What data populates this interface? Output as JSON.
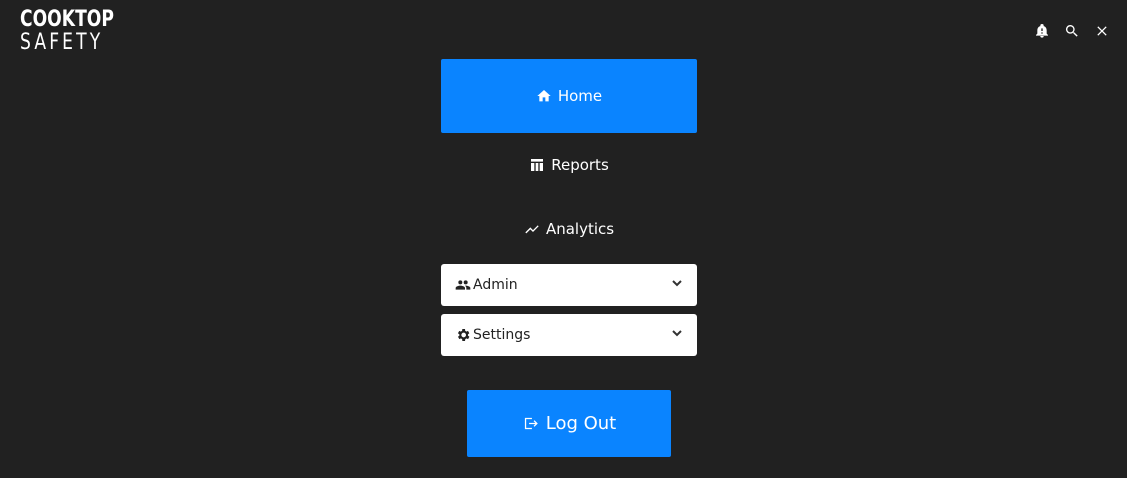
{
  "brand": {
    "line1": "COOKTOP",
    "line2": "SAFETY"
  },
  "header": {
    "icons": [
      "bell-alert-icon",
      "search-icon",
      "close-icon"
    ]
  },
  "nav": {
    "items": [
      {
        "label": "Home",
        "icon": "home-icon",
        "active": true
      },
      {
        "label": "Reports",
        "icon": "table-icon",
        "active": false
      },
      {
        "label": "Analytics",
        "icon": "trending-icon",
        "active": false
      }
    ]
  },
  "dropdowns": [
    {
      "label": "Admin",
      "icon": "users-icon"
    },
    {
      "label": "Settings",
      "icon": "gear-icon"
    }
  ],
  "logout": {
    "label": "Log Out",
    "icon": "logout-icon"
  },
  "colors": {
    "background": "#212121",
    "accent": "#0a84ff",
    "dropdown_bg": "#ffffff"
  }
}
